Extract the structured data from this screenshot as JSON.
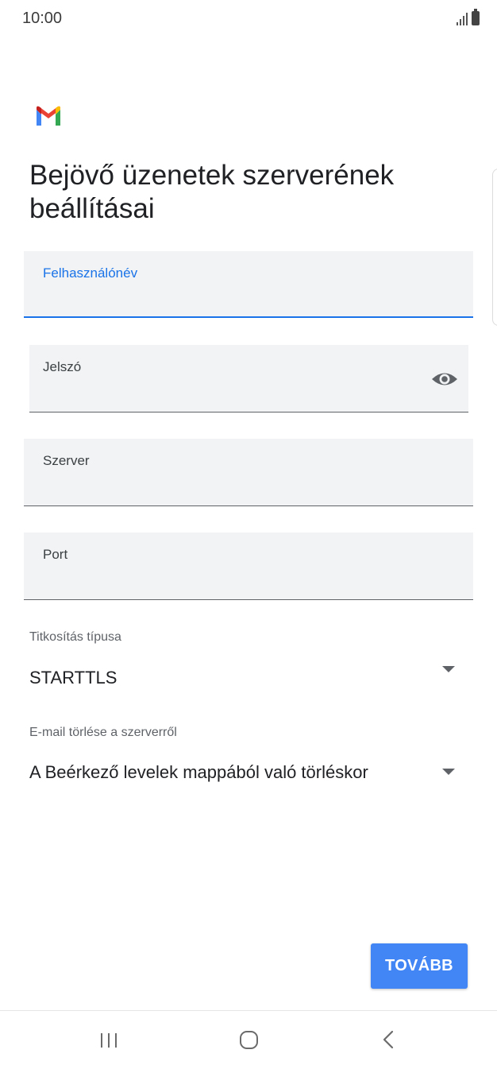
{
  "status_bar": {
    "time": "10:00"
  },
  "title": "Bejövő üzenetek szerverének beállításai",
  "fields": {
    "username": {
      "label": "Felhasználónév",
      "value": ""
    },
    "password": {
      "label": "Jelszó",
      "value": ""
    },
    "server": {
      "label": "Szerver",
      "value": ""
    },
    "port": {
      "label": "Port",
      "value": ""
    }
  },
  "encryption": {
    "label": "Titkosítás típusa",
    "value": "STARTTLS"
  },
  "delete_from_server": {
    "label": "E-mail törlése a szerverről",
    "value": "A Beérkező levelek mappából való törléskor"
  },
  "next_button": {
    "label": "TOVÁBB"
  },
  "icons": {
    "logo": "gmail-logo",
    "password_toggle": "eye-icon",
    "dropdown": "dropdown-arrow-icon",
    "nav": [
      "recent-apps-icon",
      "home-icon",
      "back-icon"
    ]
  },
  "colors": {
    "accent": "#1a73e8",
    "button": "#4285f4",
    "field_bg": "#f1f3f4"
  }
}
